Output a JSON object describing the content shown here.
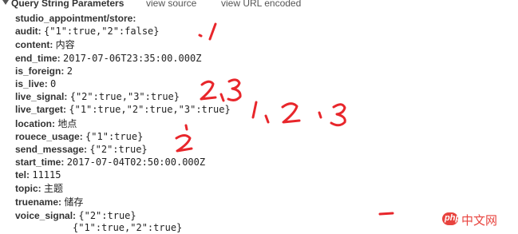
{
  "header": {
    "title": "Query String Parameters",
    "view_source": "view source",
    "view_url_encoded": "view URL encoded"
  },
  "params": [
    {
      "key": "studio_appointment/store:",
      "value": ""
    },
    {
      "key": "audit:",
      "value": "{\"1\":true,\"2\":false}"
    },
    {
      "key": "content:",
      "value": "内容"
    },
    {
      "key": "end_time:",
      "value": "2017-07-06T23:35:00.000Z"
    },
    {
      "key": "is_foreign:",
      "value": "2"
    },
    {
      "key": "is_live:",
      "value": "0"
    },
    {
      "key": "live_signal:",
      "value": "{\"2\":true,\"3\":true}"
    },
    {
      "key": "live_target:",
      "value": "{\"1\":true,\"2\":true,\"3\":true}"
    },
    {
      "key": "location:",
      "value": "地点"
    },
    {
      "key": "rouece_usage:",
      "value": "{\"1\":true}"
    },
    {
      "key": "send_message:",
      "value": "{\"2\":true}"
    },
    {
      "key": "start_time:",
      "value": "2017-07-04T02:50:00.000Z"
    },
    {
      "key": "tel:",
      "value": "11115"
    },
    {
      "key": "topic:",
      "value": "主题"
    },
    {
      "key": "truename:",
      "value": "储存"
    },
    {
      "key": "voice_signal:",
      "value": "{\"2\":true}"
    },
    {
      "key": "",
      "value": "{\"1\":true,\"2\":true}"
    }
  ],
  "annotations": {
    "color": "#e8262b",
    "near_audit": "1",
    "near_live_signal": "2, 3",
    "near_live_target": "1, 2, 3",
    "near_send_message": "2",
    "near_voice_signal": "-"
  },
  "watermark": {
    "logo_text": "php",
    "text": "中文网",
    "color": "#e8433e"
  }
}
